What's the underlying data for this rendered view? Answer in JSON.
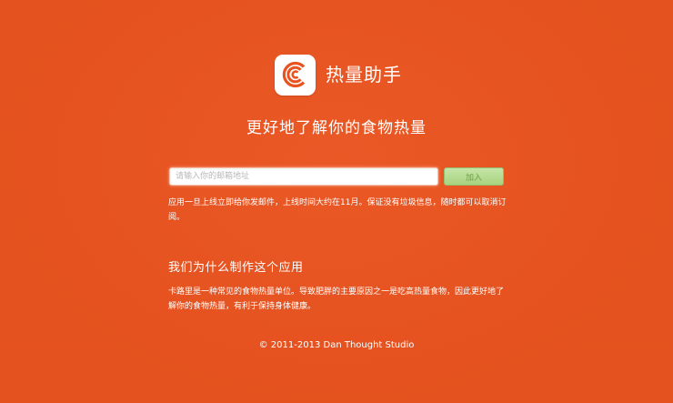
{
  "header": {
    "app_name": "热量助手",
    "logo_icon": "calorie-c-logo-icon",
    "tagline": "更好地了解你的食物热量"
  },
  "signup": {
    "email_placeholder": "请输入你的邮箱地址",
    "email_value": "",
    "join_label": "加入",
    "notice": "应用一旦上线立即给你发邮件，上线时间大约在11月。保证没有垃圾信息，随时都可以取消订阅。"
  },
  "about": {
    "heading": "我们为什么制作这个应用",
    "body": "卡路里是一种常见的食物热量单位。导致肥胖的主要原因之一是吃高热量食物，因此更好地了解你的食物热量，有利于保持身体健康。"
  },
  "footer": {
    "copyright": "© 2011-2013 Dan Thought Studio"
  },
  "colors": {
    "background": "#e9531f",
    "logo_tile": "#ffffff",
    "logo_mark": "#e9531f",
    "join_button": "#b5db90"
  }
}
